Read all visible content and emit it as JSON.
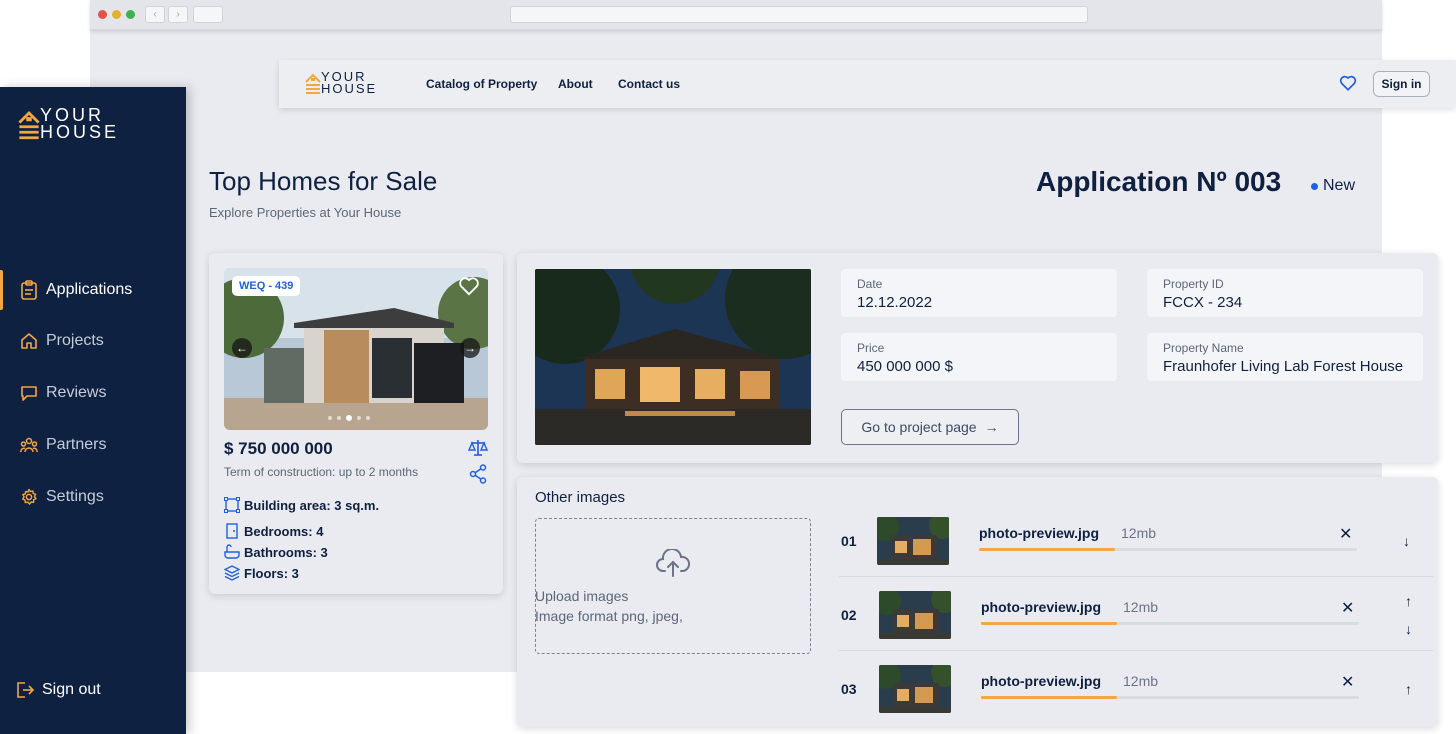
{
  "brand": {
    "line1": "YOUR",
    "line2": "HOUSE",
    "accent": "#f4a640",
    "navy": "#0f2140",
    "link_blue": "#1f5fe0"
  },
  "browser": {
    "back": "‹",
    "forward": "›"
  },
  "topnav": {
    "links": [
      "Catalog of Property",
      "About",
      "Contact us"
    ],
    "favorites_icon": "heart-icon",
    "signin_label": "Sign in"
  },
  "sidebar": {
    "items": [
      {
        "label": "Applications",
        "icon": "clipboard-icon",
        "active": true
      },
      {
        "label": "Projects",
        "icon": "home-icon",
        "active": false
      },
      {
        "label": "Reviews",
        "icon": "chat-icon",
        "active": false
      },
      {
        "label": "Partners",
        "icon": "users-icon",
        "active": false
      },
      {
        "label": "Settings",
        "icon": "gear-icon",
        "active": false
      }
    ],
    "signout_label": "Sign out"
  },
  "page": {
    "title": "Top Homes for Sale",
    "subtitle": "Explore Properties at Your House"
  },
  "application": {
    "title": "Application Nº 003",
    "status": "New",
    "fields": {
      "date_label": "Date",
      "date_value": "12.12.2022",
      "property_id_label": "Property ID",
      "property_id_value": "FCCX - 234",
      "price_label": "Price",
      "price_value": "450 000 000 $",
      "property_name_label": "Property Name",
      "property_name_value": "Fraunhofer Living Lab Forest House"
    },
    "goto_label": "Go to project page",
    "goto_arrow": "→"
  },
  "property_card": {
    "tag": "WEQ - 439",
    "price": "$ 750 000 000",
    "term": "Term of construction: up to 2 months",
    "features": {
      "area": "Building area: 3 sq.m.",
      "bedrooms": "Bedrooms: 4",
      "bathrooms": "Bathrooms: 3",
      "floors": "Floors: 3"
    },
    "slide_count": 5,
    "active_slide": 3
  },
  "other_images": {
    "title": "Other images",
    "upload_line1": "Upload images",
    "upload_line2": "Image format png, jpeg,",
    "files": [
      {
        "num": "01",
        "name": "photo-preview.jpg",
        "size": "12mb",
        "progress": 0.36,
        "arrows": [
          "↓"
        ]
      },
      {
        "num": "02",
        "name": "photo-preview.jpg",
        "size": "12mb",
        "progress": 0.36,
        "arrows": [
          "↑",
          "↓"
        ]
      },
      {
        "num": "03",
        "name": "photo-preview.jpg",
        "size": "12mb",
        "progress": 0.36,
        "arrows": [
          "↑"
        ]
      }
    ],
    "remove_glyph": "✕"
  }
}
